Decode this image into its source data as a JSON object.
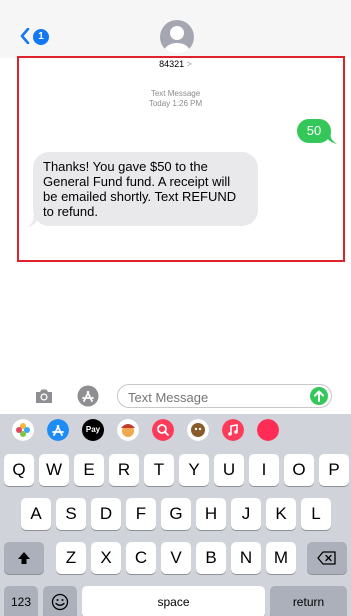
{
  "header": {
    "back_badge": "1",
    "contact": "84321",
    "contact_chevron": ">"
  },
  "conversation": {
    "timestamp_line1": "Text Message",
    "timestamp_line2": "Today 1:26 PM",
    "outgoing": "50",
    "incoming": "Thanks! You gave $50 to the General Fund fund. A receipt will be emailed shortly. Text REFUND to refund."
  },
  "input_bar": {
    "placeholder": "Text Message"
  },
  "app_strip": {
    "apple_pay_label": "Pay"
  },
  "keyboard": {
    "row1": [
      "Q",
      "W",
      "E",
      "R",
      "T",
      "Y",
      "U",
      "I",
      "O",
      "P"
    ],
    "row2": [
      "A",
      "S",
      "D",
      "F",
      "G",
      "H",
      "J",
      "K",
      "L"
    ],
    "row3": [
      "Z",
      "X",
      "C",
      "V",
      "B",
      "N",
      "M"
    ],
    "numbers_key": "123",
    "space_key": "space",
    "return_key": "return"
  },
  "colors": {
    "accent": "#1279f3",
    "sent_bubble": "#34c759",
    "received_bubble": "#e9e9eb",
    "highlight": "#e0222b"
  }
}
